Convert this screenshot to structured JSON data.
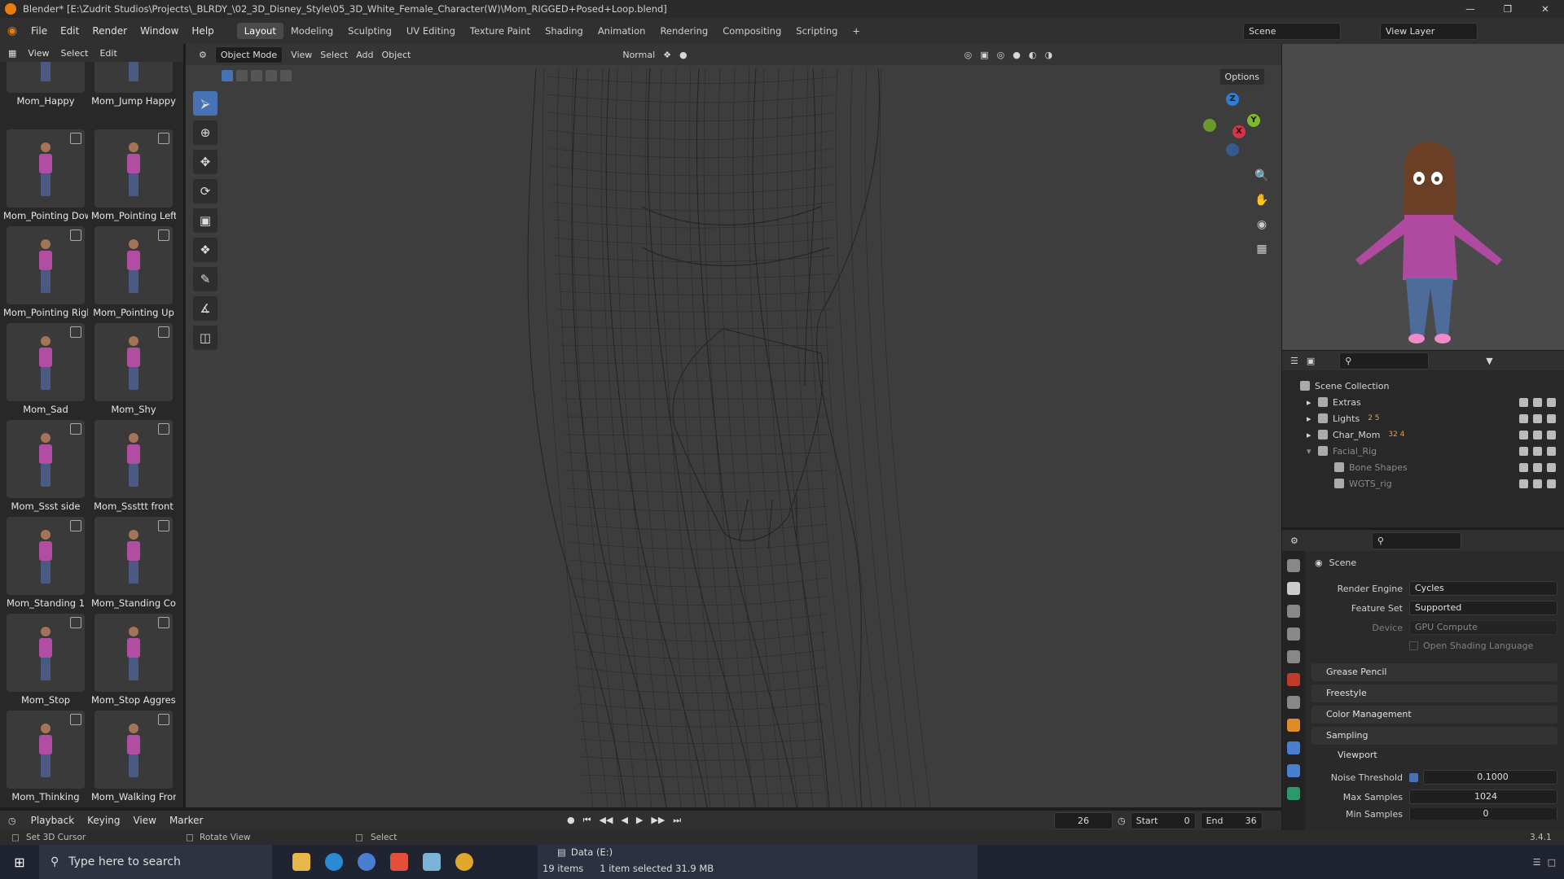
{
  "title_bar": {
    "text": "Blender* [E:\\Zudrit Studios\\Projects\\_BLRDY_\\02_3D_Disney_Style\\05_3D_White_Female_Character(W)\\Mom_RIGGED+Posed+Loop.blend]"
  },
  "menu": [
    "File",
    "Edit",
    "Render",
    "Window",
    "Help"
  ],
  "workspaces": [
    "Layout",
    "Modeling",
    "Sculpting",
    "UV Editing",
    "Texture Paint",
    "Shading",
    "Animation",
    "Rendering",
    "Compositing",
    "Scripting"
  ],
  "active_workspace": "Layout",
  "scene_name": "Scene",
  "view_layer": "View Layer",
  "asset_browser": {
    "header": [
      "View",
      "Select",
      "Edit"
    ],
    "items": [
      "Mom_Happy",
      "Mom_Jump Happy",
      "Mom_Pointing Down",
      "Mom_Pointing Left",
      "Mom_Pointing Right",
      "Mom_Pointing Up",
      "Mom_Sad",
      "Mom_Shy",
      "Mom_Ssst side",
      "Mom_Sssttt front",
      "Mom_Standing 1",
      "Mom_Standing Co...",
      "Mom_Stop",
      "Mom_Stop Aggres...",
      "Mom_Thinking",
      "Mom_Walking Front"
    ]
  },
  "viewport": {
    "mode": "Object Mode",
    "menus": [
      "View",
      "Select",
      "Add",
      "Object"
    ],
    "orientation": "Normal",
    "options": "Options"
  },
  "gizmo": {
    "x": "X",
    "y": "Y",
    "z": "Z"
  },
  "outliner": {
    "root": "Scene Collection",
    "items": [
      {
        "name": "Extras",
        "badge": ""
      },
      {
        "name": "Lights",
        "badge": "2  5"
      },
      {
        "name": "Char_Mom",
        "badge": "32  4"
      },
      {
        "name": "Facial_Rig",
        "badge": ""
      },
      {
        "name": "Bone Shapes",
        "badge": ""
      },
      {
        "name": "WGTS_rig",
        "badge": ""
      }
    ]
  },
  "properties": {
    "context": "Scene",
    "render_engine_label": "Render Engine",
    "render_engine": "Cycles",
    "feature_set_label": "Feature Set",
    "feature_set": "Supported",
    "device_label": "Device",
    "device": "GPU Compute",
    "osl": "Open Shading Language",
    "sections": [
      "Grease Pencil",
      "Freestyle",
      "Color Management",
      "Sampling"
    ],
    "viewport_sub": "Viewport",
    "noise_threshold_label": "Noise Threshold",
    "noise_threshold": "0.1000",
    "max_samples_label": "Max Samples",
    "max_samples": "1024",
    "min_samples_label": "Min Samples",
    "min_samples": "0"
  },
  "timeline": {
    "menus": [
      "Playback",
      "Keying",
      "View",
      "Marker"
    ],
    "current_frame": "26",
    "start_label": "Start",
    "start": "0",
    "end_label": "End",
    "end": "36"
  },
  "status": {
    "left": "Set 3D Cursor",
    "mid": "Rotate View",
    "right": "Select",
    "drive": "Data (E:)",
    "items": "19 items",
    "selected": "1 item selected  31.9 MB",
    "version": "3.4.1"
  },
  "taskbar": {
    "search_placeholder": "Type here to search"
  }
}
